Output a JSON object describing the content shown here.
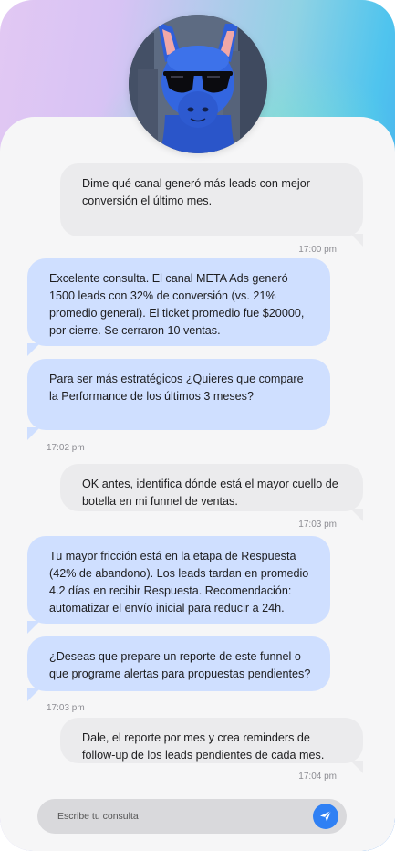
{
  "colors": {
    "accent": "#2f80f4",
    "bot_bubble": "#cfdfff",
    "user_bubble": "#ebebed",
    "background": "#f6f6f7"
  },
  "avatar": {
    "icon": "llama-avatar-icon"
  },
  "messages": [
    {
      "role": "user",
      "text": "Dime qué canal generó más leads con mejor conversión el último mes."
    },
    {
      "role": "user_time",
      "text": "17:00 pm"
    },
    {
      "role": "bot",
      "text": "Excelente consulta. El canal META Ads generó 1500 leads con 32% de conversión (vs. 21% promedio general). El ticket promedio fue $20000, por cierre. Se cerraron 10 ventas."
    },
    {
      "role": "bot",
      "text": "Para ser más estratégicos ¿Quieres que compare la Performance de los últimos 3 meses?"
    },
    {
      "role": "bot_time",
      "text": "17:02 pm"
    },
    {
      "role": "user",
      "text": "OK antes, identifica dónde está el mayor cuello de botella en mi funnel de ventas."
    },
    {
      "role": "user_time",
      "text": "17:03 pm"
    },
    {
      "role": "bot",
      "text": "Tu mayor fricción está en la etapa de Respuesta (42% de abandono). Los leads tardan en promedio 4.2 días en recibir Respuesta. Recomendación: automatizar el envío inicial para reducir a 24h."
    },
    {
      "role": "bot",
      "text": "¿Deseas que prepare un reporte de este funnel o que programe alertas para propuestas pendientes?"
    },
    {
      "role": "bot_time",
      "text": "17:03 pm"
    },
    {
      "role": "user",
      "text": "Dale, el reporte por mes y crea reminders de follow-up de los leads pendientes de cada mes."
    },
    {
      "role": "user_time",
      "text": "17:04 pm"
    }
  ],
  "composer": {
    "placeholder": "Escribe tu consulta",
    "send_icon": "send-icon"
  }
}
